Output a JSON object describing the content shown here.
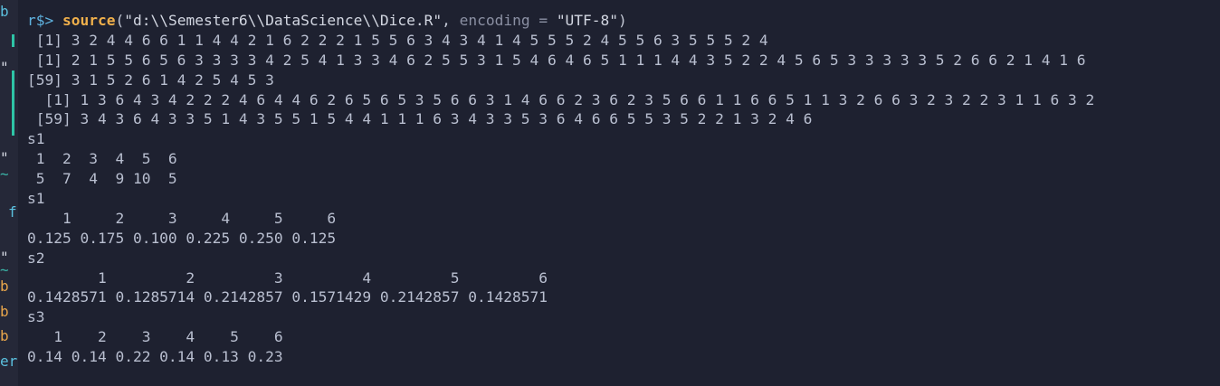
{
  "gutter": {
    "glyphs": [
      "b",
      "b",
      "b",
      "er",
      "f"
    ]
  },
  "command": {
    "prompt": "r$>",
    "function": "source",
    "open_paren": "(",
    "path": "\"d:\\\\Semester6\\\\DataScience\\\\Dice.R\"",
    "comma": ",",
    "arg_name": "encoding",
    "equals": "=",
    "arg_value": "\"UTF-8\"",
    "close_paren": ")"
  },
  "output_lines": [
    " [1] 3 2 4 4 6 6 1 1 4 4 2 1 6 2 2 2 1 5 5 6 3 4 3 4 1 4 5 5 5 2 4 5 5 6 3 5 5 5 2 4",
    " [1] 2 1 5 5 6 5 6 3 3 3 3 4 2 5 4 1 3 3 4 6 2 5 5 3 1 5 4 6 4 6 5 1 1 1 4 4 3 5 2 2 4 5 6 5 3 3 3 3 3 5 2 6 6 2 1 4 1 6",
    "[59] 3 1 5 2 6 1 4 2 5 4 5 3",
    "  [1] 1 3 6 4 3 4 2 2 2 4 6 4 4 6 2 6 5 6 5 3 5 6 6 3 1 4 6 6 2 3 6 2 3 5 6 6 1 1 6 6 5 1 1 3 2 6 6 3 2 3 2 2 3 1 1 6 3 2",
    " [59] 3 4 3 6 4 3 3 5 1 4 3 5 5 1 5 4 4 1 1 1 6 3 4 3 3 5 3 6 4 6 6 5 5 3 5 2 2 1 3 2 4 6",
    "s1",
    " 1  2  3  4  5  6",
    " 5  7  4  9 10  5",
    "s1",
    "    1     2     3     4     5     6",
    "0.125 0.175 0.100 0.225 0.250 0.125",
    "s2",
    "        1         2         3         4         5         6",
    "0.1428571 0.1285714 0.2142857 0.1571429 0.2142857 0.1428571",
    "s3",
    "   1    2    3    4    5    6",
    "0.14 0.14 0.22 0.14 0.13 0.23"
  ],
  "colors": {
    "background": "#1e2130",
    "prompt": "#5fb3e0",
    "function": "#f0b04b",
    "output": "#b9bfd0",
    "gutter_accent": "#2ec4a6"
  }
}
